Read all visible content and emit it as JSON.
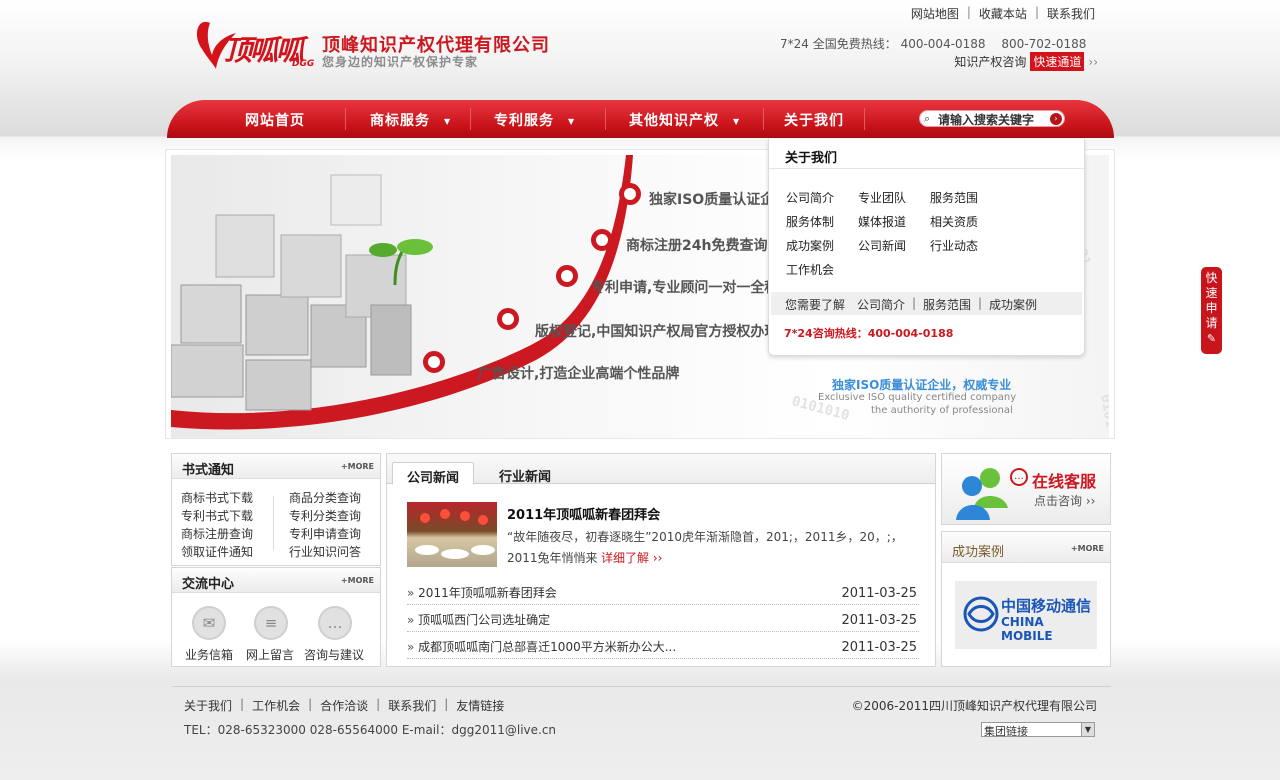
{
  "header": {
    "logo_text": "顶呱呱",
    "logo_sub": "DGG",
    "company_name": "顶峰知识产权代理有限公司",
    "slogan": "您身边的知识产权保护专家",
    "top_links": [
      "网站地图",
      "收藏本站",
      "联系我们"
    ],
    "hotline_label": "7*24 全国免费热线：",
    "hotline_1": "400-004-0188",
    "hotline_2": "800-702-0188",
    "consult_label": "知识产权咨询",
    "quick_channel": "快速通道"
  },
  "nav": {
    "items": [
      "网站首页",
      "商标服务",
      "专利服务",
      "其他知识产权",
      "关于我们"
    ],
    "search_placeholder": "请输入搜索关键字"
  },
  "banner": {
    "lines": [
      "独家ISO质量认证企业",
      "商标注册24h免费查询",
      "专利申请,专业顾问一对一全程服务",
      "版权登记,中国知识产权局官方授权办理",
      "广告设计,打造企业高端个性品牌"
    ],
    "iso_cn": "独家ISO质量认证企业，权威专业",
    "iso_en_1": "Exclusive ISO quality certified company",
    "iso_en_2": "the authority of professional"
  },
  "dropdown": {
    "title": "关于我们",
    "links": [
      "公司简介",
      "专业团队",
      "服务范围",
      "服务体制",
      "媒体报道",
      "相关资质",
      "成功案例",
      "公司新闻",
      "行业动态",
      "工作机会"
    ],
    "need_label": "您需要了解",
    "need_links": [
      "公司简介",
      "服务范围",
      "成功案例"
    ],
    "hotline": "7*24咨询热线：400-004-0188"
  },
  "float_button": "快速申请",
  "notice": {
    "title": "书式通知",
    "more": "+MORE",
    "left": [
      "商标书式下载",
      "专利书式下载",
      "商标注册查询",
      "领取证件通知"
    ],
    "right": [
      "商品分类查询",
      "专利分类查询",
      "专利申请查询",
      "行业知识问答"
    ]
  },
  "exchange": {
    "title": "交流中心",
    "more": "+MORE",
    "items": [
      "业务信箱",
      "网上留言",
      "咨询与建议"
    ]
  },
  "news": {
    "tabs": [
      "公司新闻",
      "行业新闻"
    ],
    "featured_title": "2011年顶呱呱新春团拜会",
    "featured_summary": "“故年随夜尽，初春逐晓生”2010虎年渐渐隐首，201;，2011乡，20，;，2011兔年悄悄来报道!",
    "featured_more": "详细了解",
    "rows": [
      {
        "title": "2011年顶呱呱新春团拜会",
        "date": "2011-03-25"
      },
      {
        "title": "顶呱呱西门公司选址确定",
        "date": "2011-03-25"
      },
      {
        "title": "成都顶呱呱南门总部喜迁1000平方米新办公大...",
        "date": "2011-03-25"
      }
    ]
  },
  "service": {
    "title": "在线客服",
    "sub": "点击咨询"
  },
  "cases": {
    "title": "成功案例",
    "more": "+MORE",
    "logo_cn": "中国移动通信",
    "logo_en": "CHINA MOBILE"
  },
  "footer": {
    "links": [
      "关于我们",
      "工作机会",
      "合作洽谈",
      "联系我们",
      "友情链接"
    ],
    "copyright": "©2006-2011四川顶峰知识产权代理有限公司",
    "contact": "TEL：028-65323000 028-65564000   E-mail：dgg2011@live.cn",
    "select_value": "集团链接"
  }
}
